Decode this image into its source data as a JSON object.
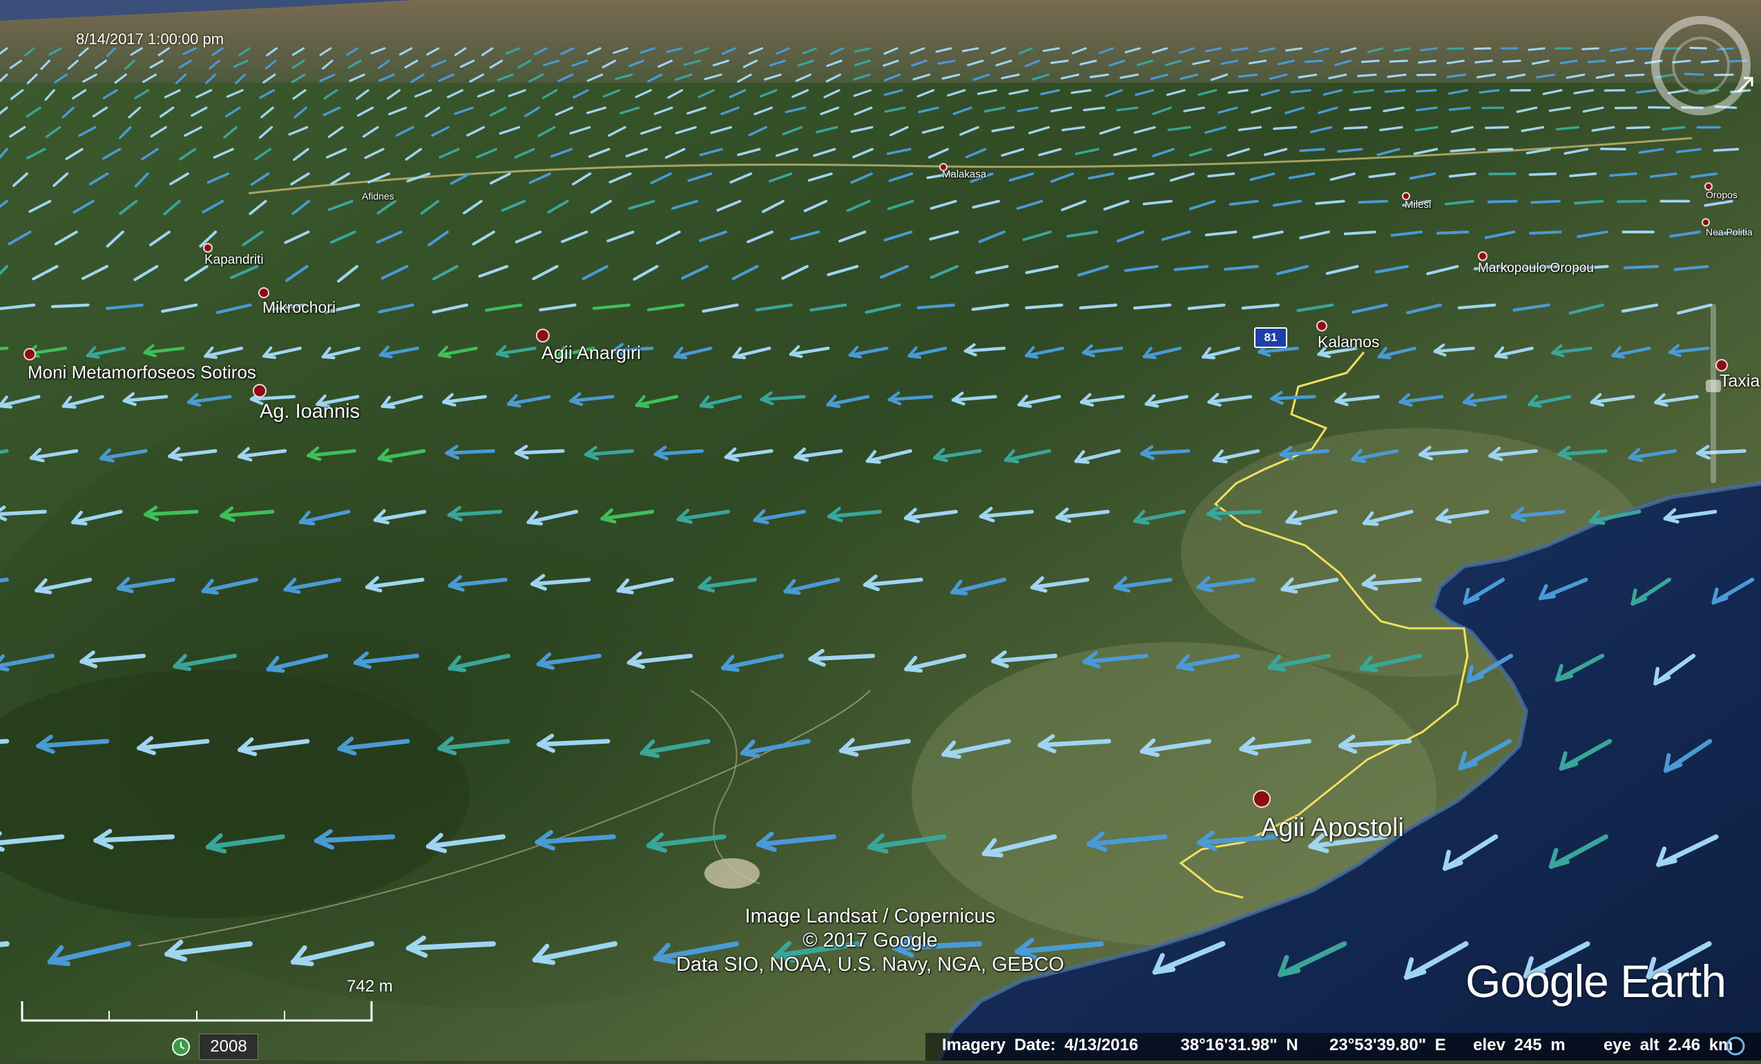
{
  "view": {
    "timestamp": "8/14/2017   1:00:00 pm",
    "year_slider": "2008",
    "logo": "Google Earth"
  },
  "places": [
    {
      "name": "Moni Metamorfoseos Sotiros"
    },
    {
      "name": "Ag. Ioannis"
    },
    {
      "name": "Agii Anargiri"
    },
    {
      "name": "Mikrochori"
    },
    {
      "name": "Kapandriti"
    },
    {
      "name": "Malakasa"
    },
    {
      "name": "Kalamos"
    },
    {
      "name": "Markopoulo Oropou"
    },
    {
      "name": "Milesi"
    },
    {
      "name": "Nea Politia"
    },
    {
      "name": "Oropos"
    },
    {
      "name": "Taxia"
    },
    {
      "name": "Agii Apostoli"
    },
    {
      "name": "Afidnes"
    }
  ],
  "road_shield": "81",
  "attribution": [
    "Image Landsat / Copernicus",
    "© 2017 Google",
    "Data SIO, NOAA, U.S. Navy, NGA, GEBCO"
  ],
  "scale": "742 m",
  "status": {
    "imagery_date": "Imagery Date: 4/13/2016",
    "latitude": "38°16'31.98\" N",
    "longitude": "23°53'39.80\" E",
    "elevation": "elev    245 m",
    "eye_altitude": "eye alt    2.46 km"
  },
  "colors": {
    "terrain_dark": "#2f4a24",
    "terrain_light": "#6f7e52",
    "sea": "#12264d",
    "coast_path": "#f0e060",
    "pin": "#8b0c14",
    "arrow_light": "#9fd4f2",
    "arrow_mid": "#4a9ad6",
    "arrow_teal": "#3aa69a",
    "arrow_green": "#3fbf5a"
  }
}
